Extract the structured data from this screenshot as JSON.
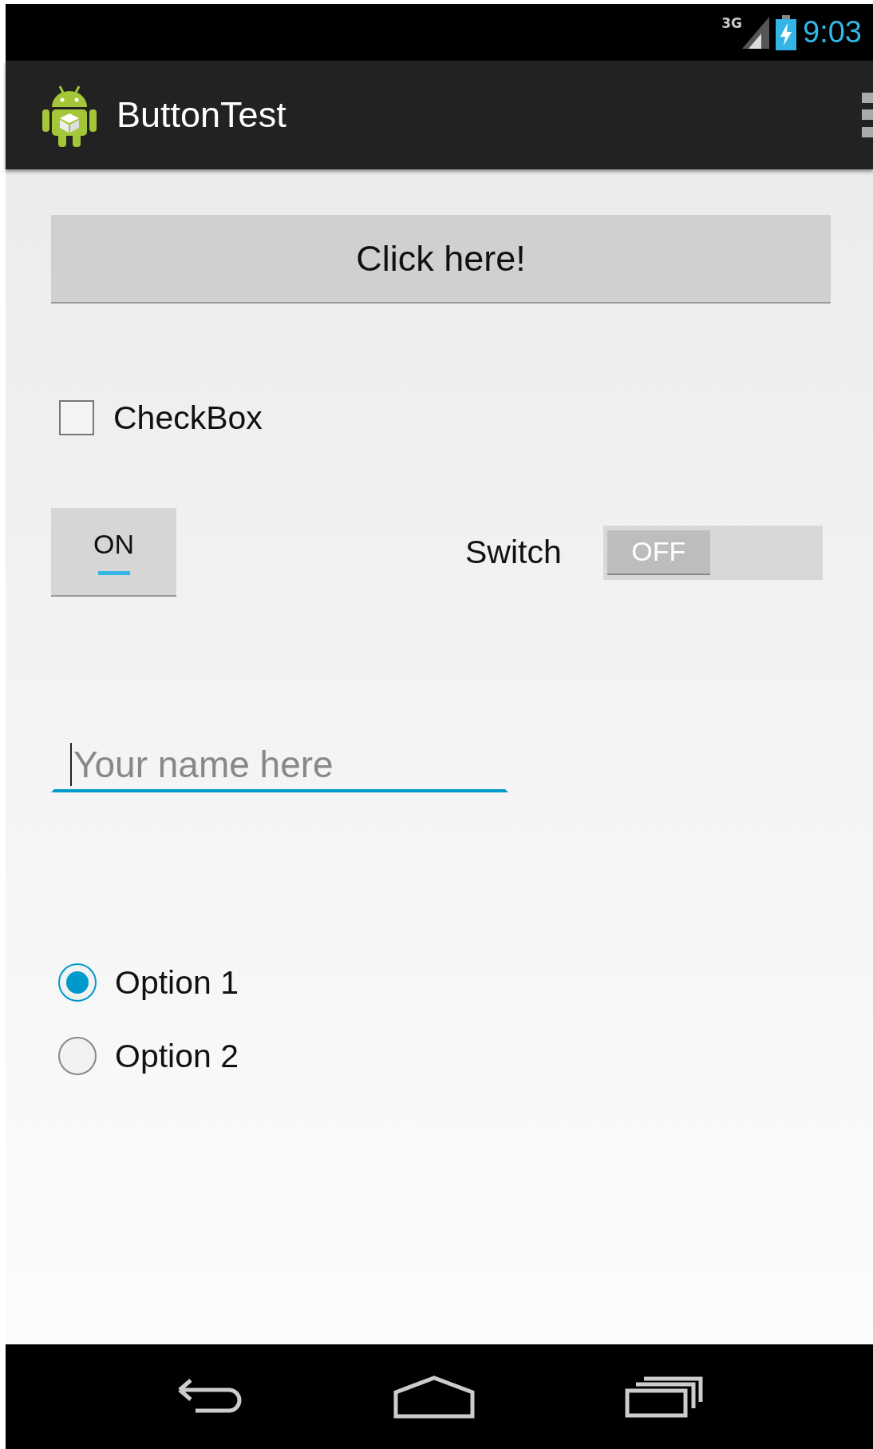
{
  "status_bar": {
    "network": "3G",
    "time": "9:03"
  },
  "action_bar": {
    "title": "ButtonTest"
  },
  "button": {
    "label": "Click here!"
  },
  "checkbox": {
    "label": "CheckBox",
    "checked": false
  },
  "toggle_button": {
    "label": "ON",
    "on": true
  },
  "switch": {
    "label": "Switch",
    "thumb_label": "OFF",
    "on": false
  },
  "text_field": {
    "placeholder": "Your name here",
    "focused": true
  },
  "radio_group": [
    {
      "label": "Option 1",
      "selected": true
    },
    {
      "label": "Option 2",
      "selected": false
    }
  ]
}
